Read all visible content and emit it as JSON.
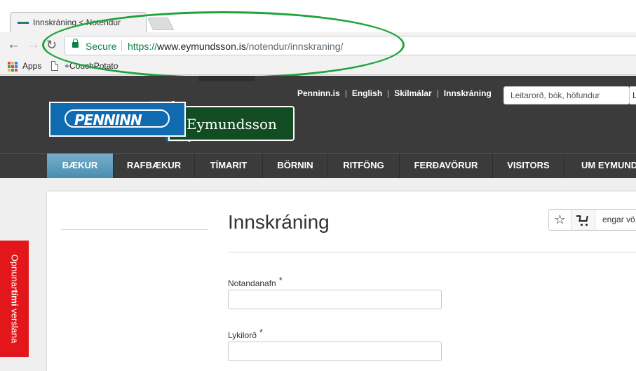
{
  "browser": {
    "tab_title": "Innskráning < Notendur",
    "secure_label": "Secure",
    "url": {
      "protocol": "https://",
      "host": "www.eymundsson.is",
      "path": "/notendur/innskraning/"
    },
    "bookmarks": [
      {
        "label": "Apps",
        "icon": "apps-grid-icon"
      },
      {
        "label": "+CouchPotato",
        "icon": "document-icon"
      }
    ],
    "annotation_color": "#1fa33b"
  },
  "site": {
    "top_links": [
      "Penninn.is",
      "English",
      "Skilmálar",
      "Innskráning"
    ],
    "search_placeholder": "Leitarorð, bók, höfundur",
    "search_button_label": "L",
    "logo": {
      "left_text": "PENNINN",
      "right_text": "Eymundsson"
    },
    "main_nav": [
      "BÆKUR",
      "RAFBÆKUR",
      "TÍMARIT",
      "BÖRNIN",
      "RITFÖNG",
      "FERÐAVÖRUR",
      "VISITORS",
      "UM EYMUNDS"
    ],
    "active_nav_index": 0,
    "colors": {
      "header_bg": "#3b3b3b",
      "logo_blue": "#0f6ab0",
      "logo_green": "#124c22",
      "nav_active": "#5a9dbd",
      "hours_tab": "#e3171b"
    }
  },
  "login": {
    "title": "Innskráning",
    "username_label": "Notandanafn",
    "username_value": "",
    "password_label": "Lykilorð",
    "password_value": "",
    "required_marker": "*"
  },
  "cart": {
    "label": "engar vö"
  },
  "hours_tab": {
    "text_before": "Opnunar",
    "text_bold": "tími",
    "text_after": " verslana"
  }
}
